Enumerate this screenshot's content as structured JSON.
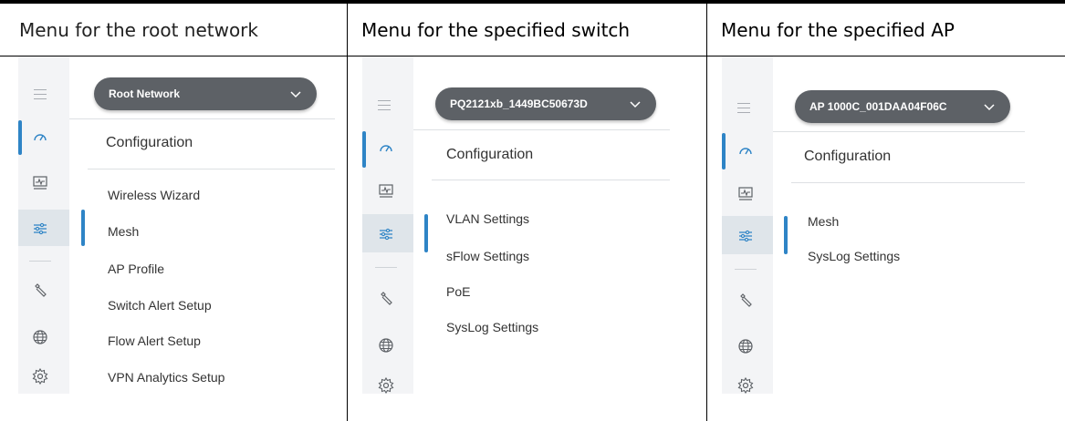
{
  "columns": [
    {
      "header": "Menu for the root network",
      "dropdown": "Root Network",
      "title": "Configuration",
      "items": [
        "Wireless Wizard",
        "Mesh",
        "AP Profile",
        "Switch Alert Setup",
        "Flow Alert Setup",
        "VPN Analytics Setup"
      ]
    },
    {
      "header": "Menu for the specified switch",
      "dropdown": "PQ2121xb_1449BC50673D",
      "title": "Configuration",
      "items": [
        "VLAN Settings",
        "sFlow Settings",
        "PoE",
        "SysLog Settings"
      ]
    },
    {
      "header": "Menu for the specified AP",
      "dropdown": "AP 1000C_001DAA04F06C",
      "title": "Configuration",
      "items": [
        "Mesh",
        "SysLog Settings"
      ]
    }
  ],
  "icons": [
    "hamburger-icon",
    "dashboard-icon",
    "monitor-icon",
    "sliders-icon",
    "wrench-icon",
    "globe-icon",
    "gear-icon",
    "chevron-down-icon"
  ],
  "colors": {
    "accent": "#2e84c6",
    "dropdown_bg": "#5d6166",
    "sidebar_bg": "#f3f4f6",
    "selected_bg": "#dfe5ea",
    "icon": "#5d6166",
    "icon_active": "#2e84c6"
  }
}
